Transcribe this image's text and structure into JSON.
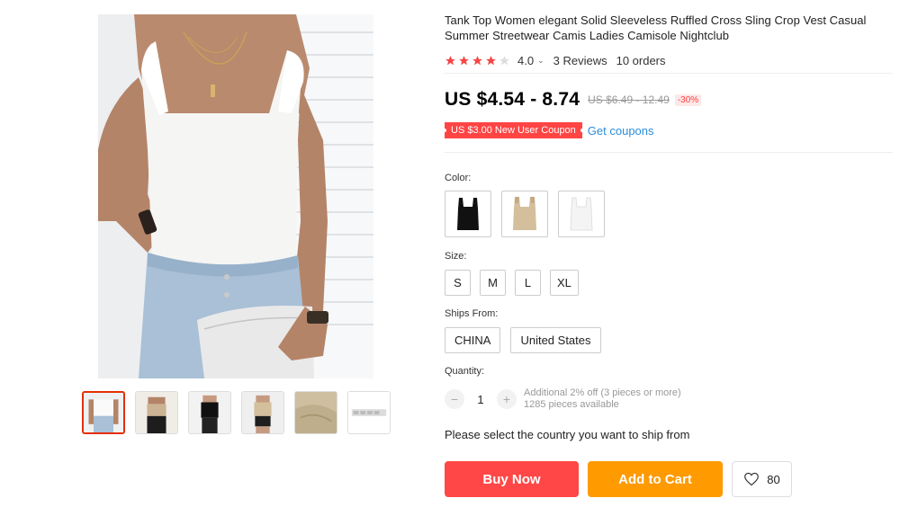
{
  "product": {
    "title": "Tank Top Women elegant Solid Sleeveless Ruffled Cross Sling Crop Vest Casual Summer Streetwear Camis Ladies Camisole Nightclub",
    "rating": {
      "value": "4.0",
      "stars_filled": 4,
      "stars_total": 5,
      "reviews": "3 Reviews",
      "orders": "10 orders"
    },
    "price": {
      "current": "US $4.54 - 8.74",
      "original": "US $6.49 - 12.49",
      "discount": "-30%"
    },
    "coupon": {
      "label": "US $3.00 New User Coupon",
      "link": "Get coupons"
    },
    "color": {
      "label": "Color:",
      "options": [
        {
          "name": "black-tank-swatch",
          "color": "#111111"
        },
        {
          "name": "khaki-tank-swatch",
          "color": "#d3bf9c"
        },
        {
          "name": "white-tank-swatch",
          "color": "#f4f4f4"
        }
      ]
    },
    "size": {
      "label": "Size:",
      "options": [
        "S",
        "M",
        "L",
        "XL"
      ]
    },
    "ships_from": {
      "label": "Ships From:",
      "options": [
        "CHINA",
        "United States"
      ]
    },
    "quantity": {
      "label": "Quantity:",
      "value": "1",
      "minus": "−",
      "plus": "+",
      "note_line1": "Additional 2% off (3 pieces or more)",
      "note_line2": "1285 pieces available"
    },
    "ship_note": "Please select the country you want to ship from",
    "buttons": {
      "buy_now": "Buy Now",
      "add_to_cart": "Add to Cart",
      "wishlist_count": "80"
    },
    "colors": {
      "star_filled": "#f44747",
      "star_empty": "#dddddd",
      "buy_now": "#ff4747",
      "add_to_cart": "#ff9a00",
      "coupon_bg": "#ff4747",
      "link": "#2b8dd9"
    }
  }
}
